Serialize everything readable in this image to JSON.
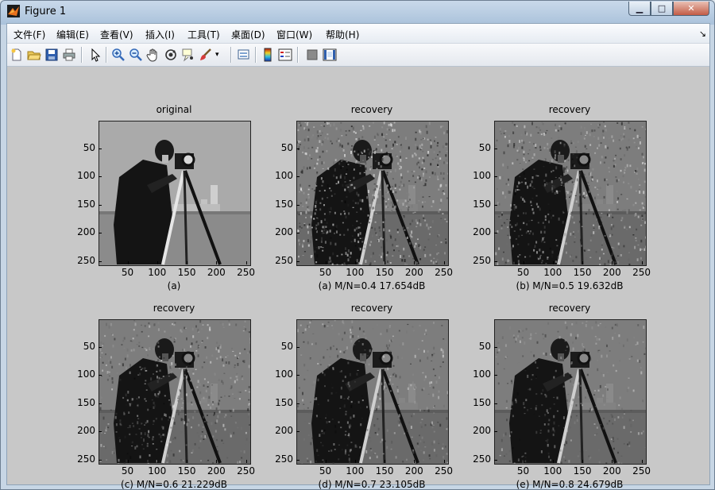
{
  "window": {
    "title": "Figure 1"
  },
  "menu": [
    "文件(F)",
    "编辑(E)",
    "查看(V)",
    "插入(I)",
    "工具(T)",
    "桌面(D)",
    "窗口(W)",
    "帮助(H)"
  ],
  "toolbar_icons": [
    "new-figure-icon",
    "open-file-icon",
    "save-icon",
    "print-icon",
    "edit-plot-arrow-icon",
    "zoom-in-icon",
    "zoom-out-icon",
    "pan-hand-icon",
    "rotate-3d-icon",
    "data-cursor-icon",
    "brush-icon",
    "brush-dropdown-icon",
    "link-plot-icon",
    "insert-colorbar-icon",
    "insert-legend-icon",
    "hide-plot-tools-icon",
    "show-plot-tools-icon"
  ],
  "panels": [
    {
      "title": "original",
      "caption": "(a)",
      "noise": 0.0
    },
    {
      "title": "recovery",
      "caption": "(a)  M/N=0.4   17.654dB",
      "noise": 0.55
    },
    {
      "title": "recovery",
      "caption": "(b)  M/N=0.5   19.632dB",
      "noise": 0.45
    },
    {
      "title": "recovery",
      "caption": "(c)  M/N=0.6   21.229dB",
      "noise": 0.38
    },
    {
      "title": "recovery",
      "caption": "(d)  M/N=0.7   23.105dB",
      "noise": 0.3
    },
    {
      "title": "recovery",
      "caption": "(e)  M/N=0.8   24.679dB",
      "noise": 0.24
    }
  ],
  "axis": {
    "y_ticks": [
      50,
      100,
      150,
      200,
      250
    ],
    "x_ticks": [
      50,
      100,
      150,
      200,
      250
    ],
    "range": [
      1,
      256
    ]
  }
}
